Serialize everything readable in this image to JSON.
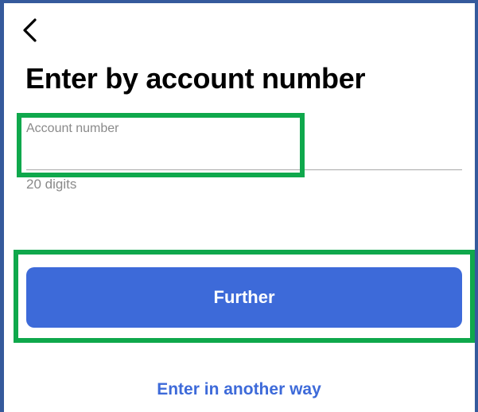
{
  "header": {
    "back_icon": "chevron-left-icon",
    "title": "Enter by account number"
  },
  "form": {
    "account_label": "Account number",
    "account_value": "",
    "hint": "20 digits"
  },
  "actions": {
    "further_label": "Further",
    "alt_link_label": "Enter in another way"
  },
  "colors": {
    "frame": "#355a9c",
    "highlight": "#0fa84c",
    "accent": "#3d6ad9",
    "muted_text": "#8a8a8a"
  }
}
